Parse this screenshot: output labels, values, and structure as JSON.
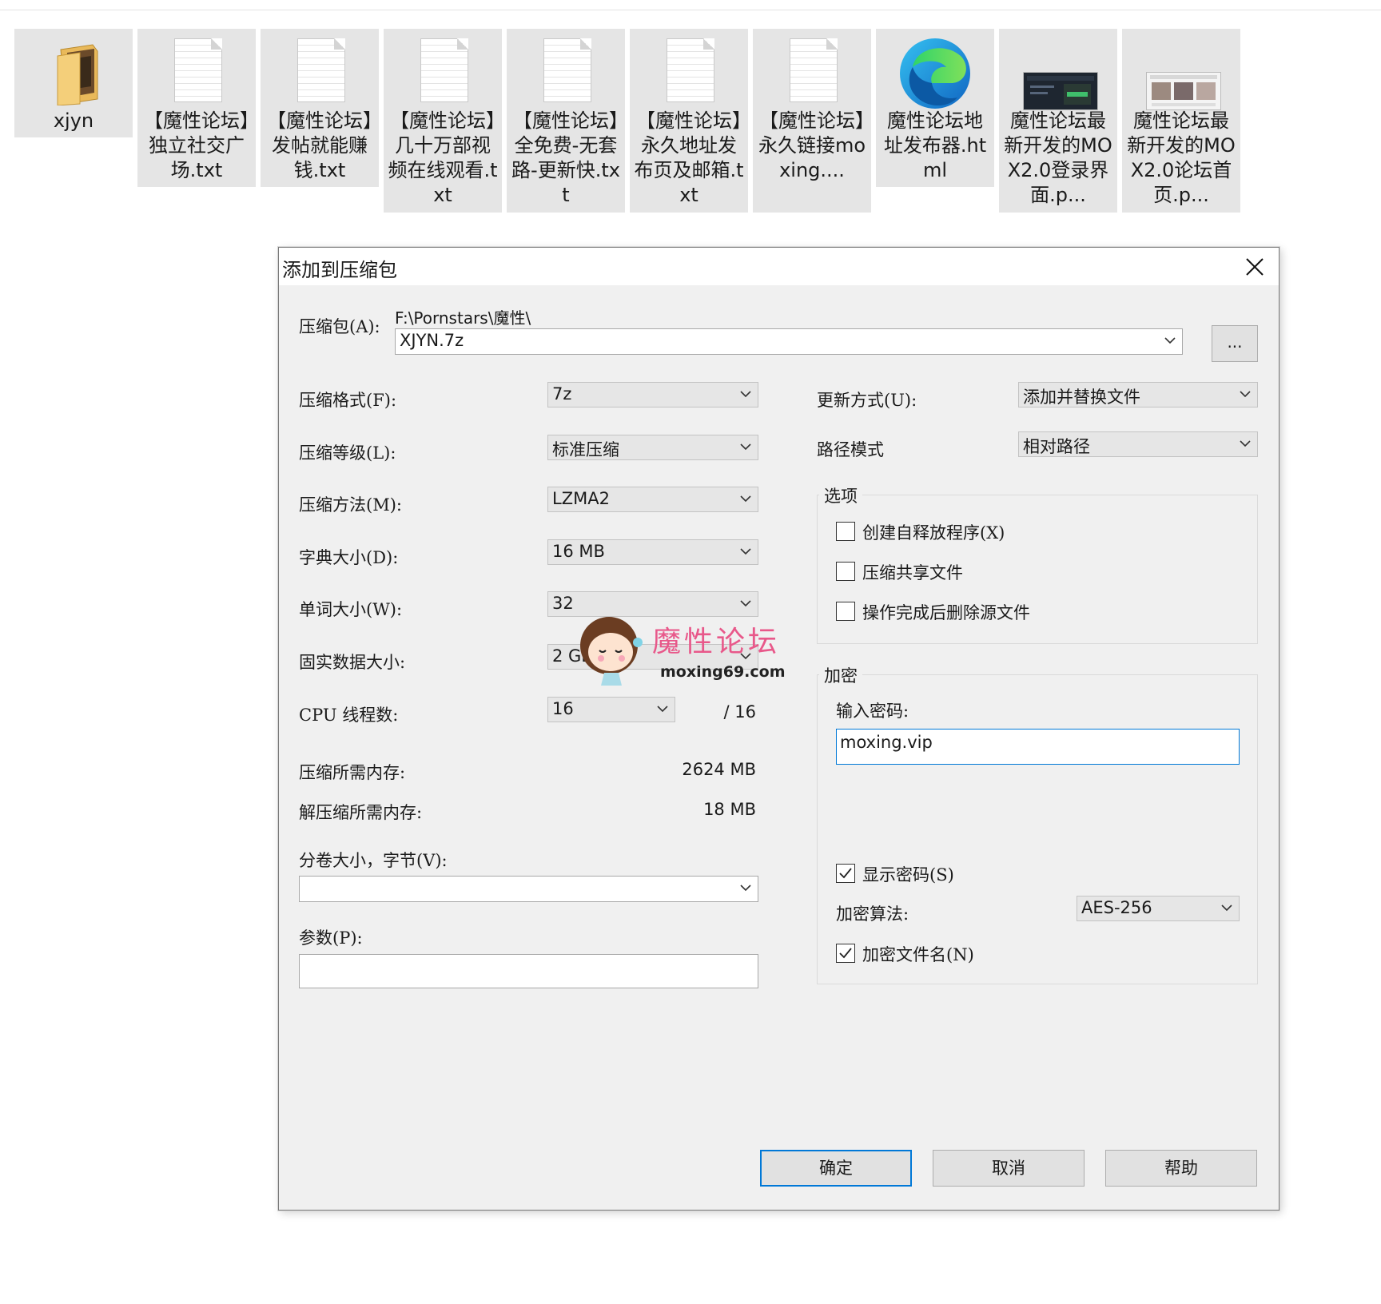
{
  "files": [
    {
      "name": "xjyn",
      "type": "folder"
    },
    {
      "name": "【魔性论坛】独立社交广场.txt",
      "type": "text"
    },
    {
      "name": "【魔性论坛】发帖就能赚钱.txt",
      "type": "text"
    },
    {
      "name": "【魔性论坛】几十万部视频在线观看.txt",
      "type": "text"
    },
    {
      "name": "【魔性论坛】全免费-无套路-更新快.txt",
      "type": "text"
    },
    {
      "name": "【魔性论坛】永久地址发布页及邮箱.txt",
      "type": "text"
    },
    {
      "name": "【魔性论坛】永久链接moxing....",
      "type": "text"
    },
    {
      "name": "魔性论坛地址发布器.html",
      "type": "edge-html"
    },
    {
      "name": "魔性论坛最新开发的MOX2.0登录界面.p...",
      "type": "image-dark"
    },
    {
      "name": "魔性论坛最新开发的MOX2.0论坛首页.p...",
      "type": "image-light"
    }
  ],
  "dialog": {
    "title": "添加到压缩包",
    "archive_label": "压缩包(A):",
    "archive_path": "F:\\Pornstars\\魔性\\",
    "archive_name": "XJYN.7z",
    "browse_label": "...",
    "left": {
      "format": {
        "label": "压缩格式(F):",
        "value": "7z"
      },
      "level": {
        "label": "压缩等级(L):",
        "value": "标准压缩"
      },
      "method": {
        "label": "压缩方法(M):",
        "value": "LZMA2"
      },
      "dict": {
        "label": "字典大小(D):",
        "value": "16 MB"
      },
      "word": {
        "label": "单词大小(W):",
        "value": "32"
      },
      "solid": {
        "label": "固实数据大小:",
        "value": "2 GB"
      },
      "cpu": {
        "label": "CPU 线程数:",
        "value": "16",
        "max": "/ 16"
      },
      "mem_comp": {
        "label": "压缩所需内存:",
        "value": "2624 MB"
      },
      "mem_decomp": {
        "label": "解压缩所需内存:",
        "value": "18 MB"
      },
      "volume": {
        "label": "分卷大小，字节(V):",
        "value": ""
      },
      "params": {
        "label": "参数(P):",
        "value": ""
      }
    },
    "right": {
      "update": {
        "label": "更新方式(U):",
        "value": "添加并替换文件"
      },
      "path": {
        "label": "路径模式",
        "value": "相对路径"
      },
      "options": {
        "label": "选项",
        "sfx": {
          "label": "创建自释放程序(X)",
          "checked": false
        },
        "shared": {
          "label": "压缩共享文件",
          "checked": false
        },
        "delete": {
          "label": "操作完成后删除源文件",
          "checked": false
        }
      },
      "encryption": {
        "label": "加密",
        "password_label": "输入密码:",
        "password": "moxing.vip",
        "show_password": {
          "label": "显示密码(S)",
          "checked": true
        },
        "algo_label": "加密算法:",
        "algo": "AES-256",
        "encrypt_names": {
          "label": "加密文件名(N)",
          "checked": true
        }
      }
    },
    "buttons": {
      "ok": "确定",
      "cancel": "取消",
      "help": "帮助"
    }
  },
  "watermark": {
    "text": "魔性论坛",
    "url": "moxing69.com"
  },
  "colors": {
    "accent": "#0078d7",
    "watermark": "#e8588a"
  }
}
